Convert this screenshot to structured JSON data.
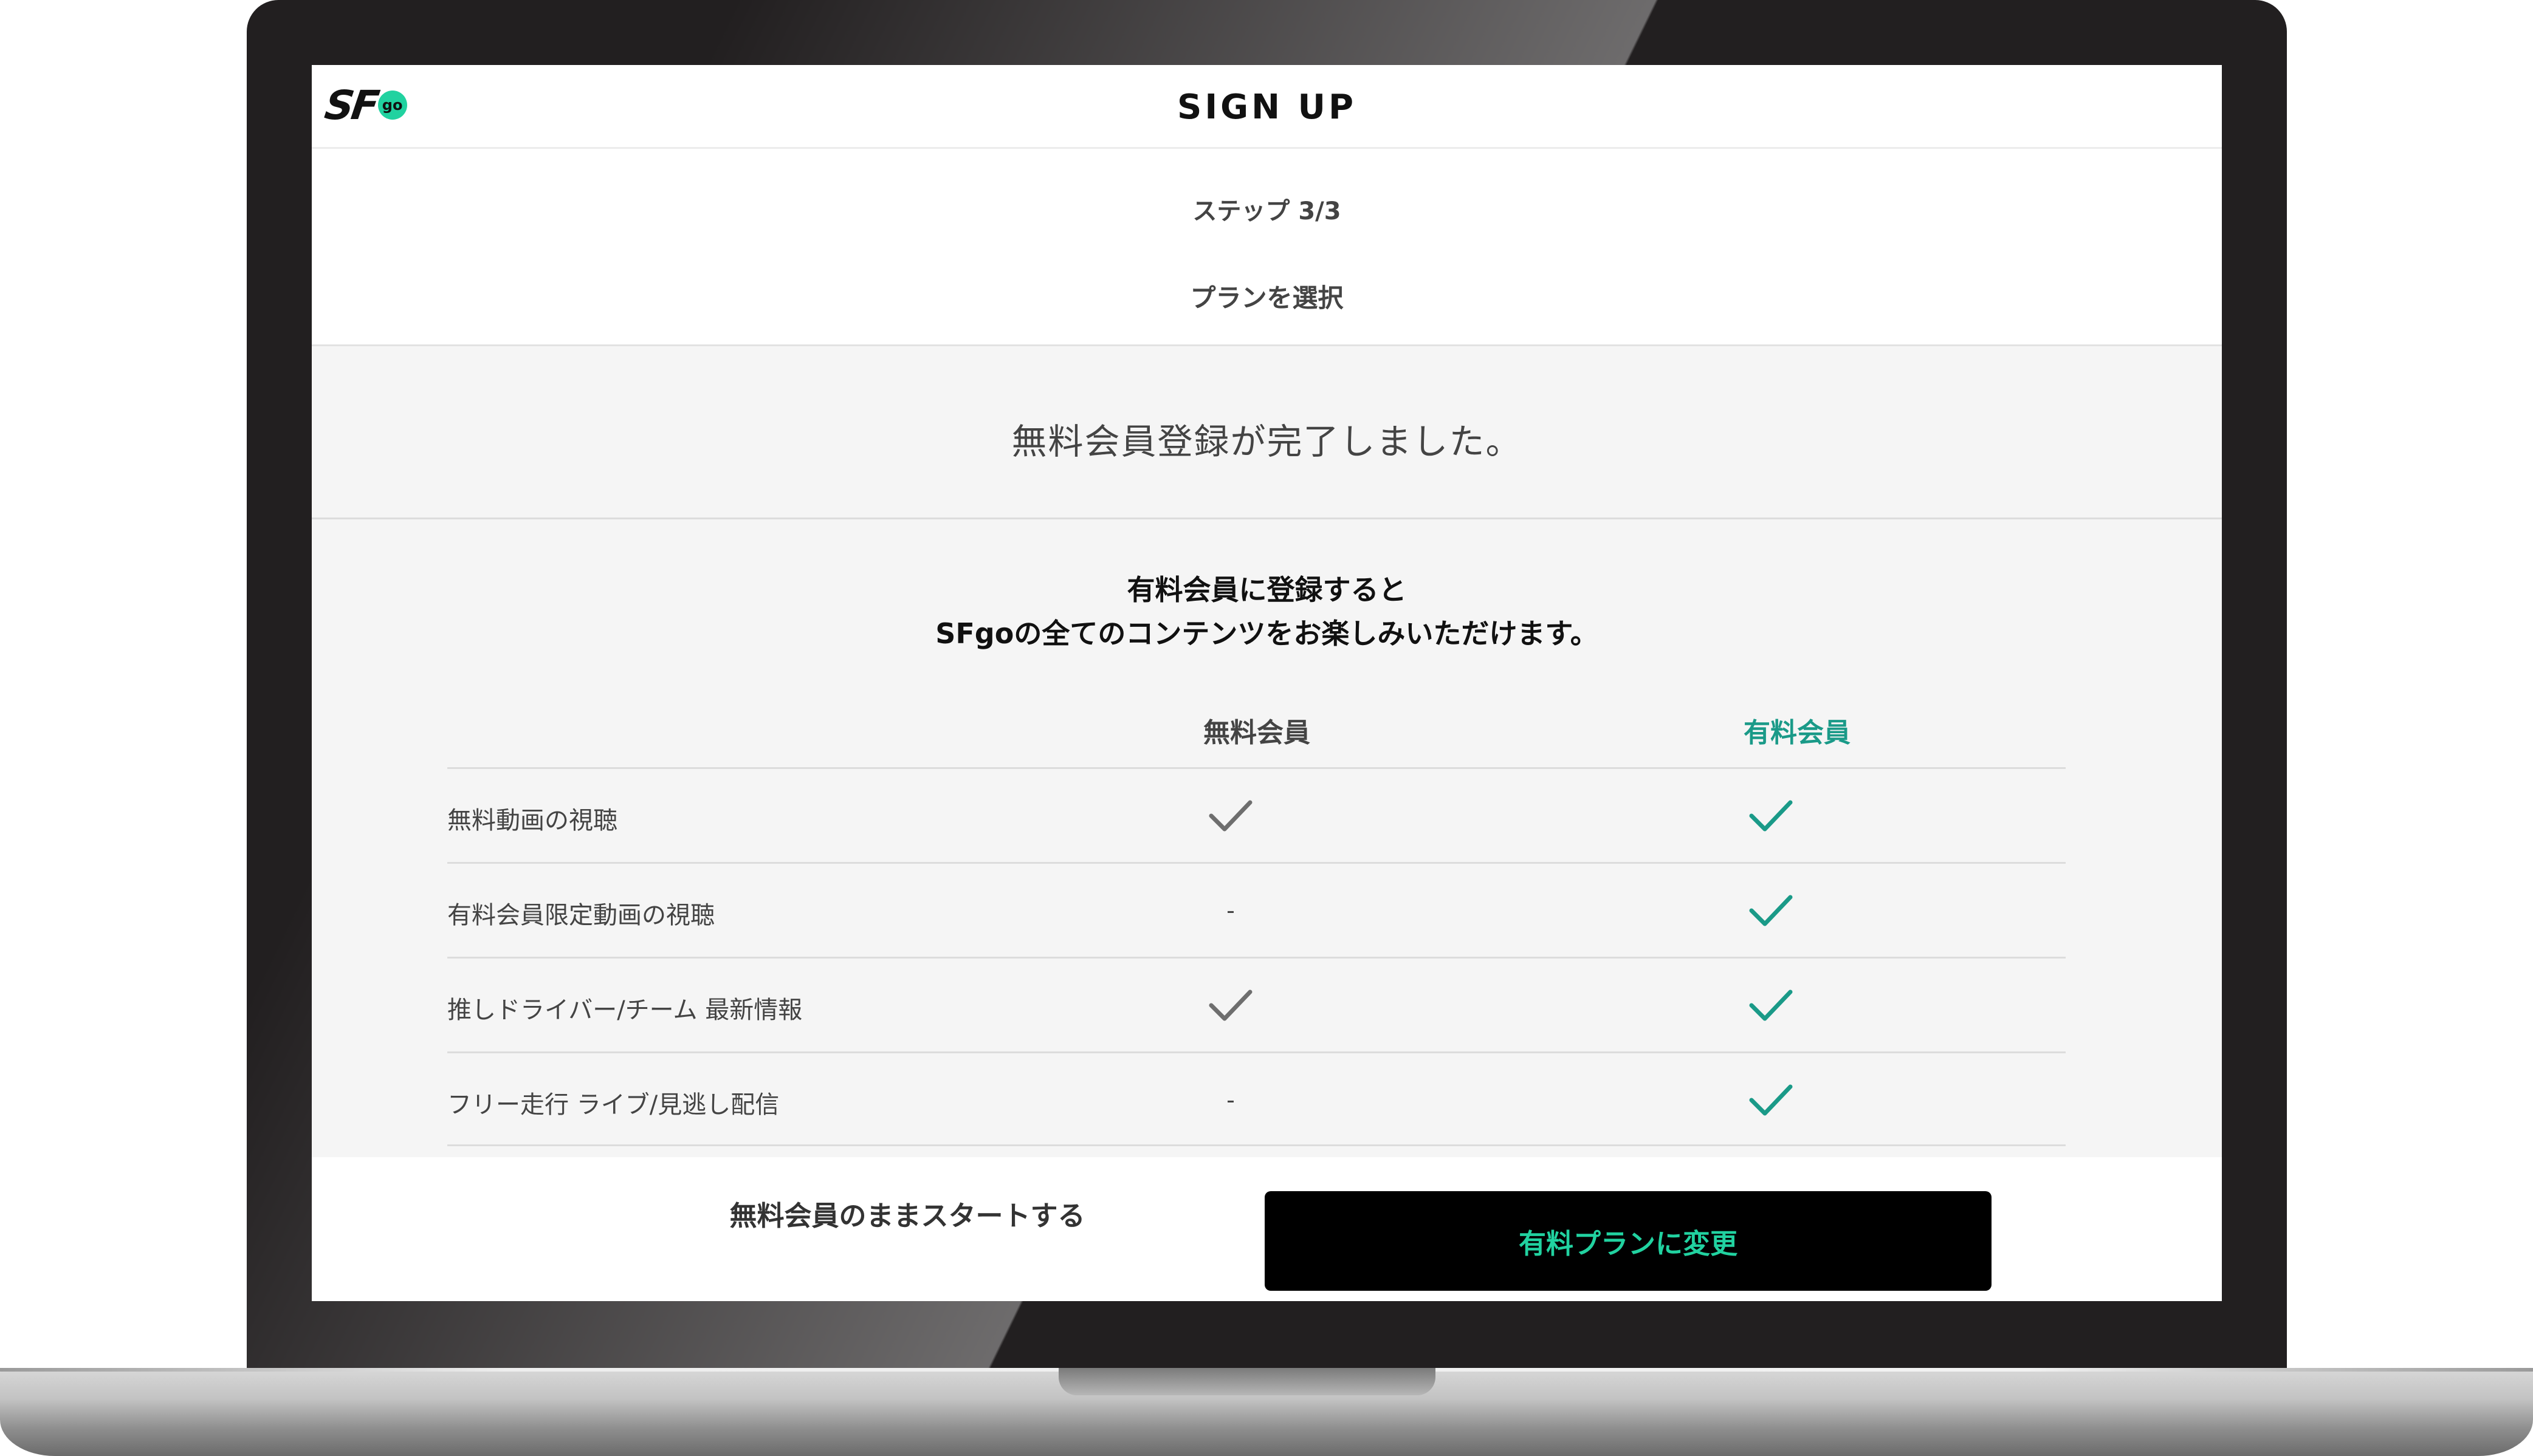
{
  "header": {
    "logo_text": "SF",
    "logo_badge": "go",
    "title": "SIGN UP"
  },
  "step": {
    "label": "ステップ 3/3",
    "subtitle": "プランを選択"
  },
  "complete_message": "無料会員登録が完了しました。",
  "promo": {
    "line1": "有料会員に登録すると",
    "line2": "SFgoの全てのコンテンツをお楽しみいただけます。"
  },
  "plans": {
    "free_label": "無料会員",
    "paid_label": "有料会員"
  },
  "features": [
    {
      "name": "無料動画の視聴",
      "free": "check",
      "paid": "check"
    },
    {
      "name": "有料会員限定動画の視聴",
      "free": "-",
      "paid": "check"
    },
    {
      "name": "推しドライバー/チーム 最新情報",
      "free": "check",
      "paid": "check"
    },
    {
      "name": "フリー走行 ライブ/見逃し配信",
      "free": "-",
      "paid": "check"
    }
  ],
  "buttons": {
    "continue_free": "無料会員のままスタートする",
    "upgrade": "有料プランに変更"
  },
  "colors": {
    "accent": "#21d2a0",
    "paid_teal": "#1a9a88",
    "check_gray": "#6e6e6e",
    "frame": "#221f20"
  }
}
